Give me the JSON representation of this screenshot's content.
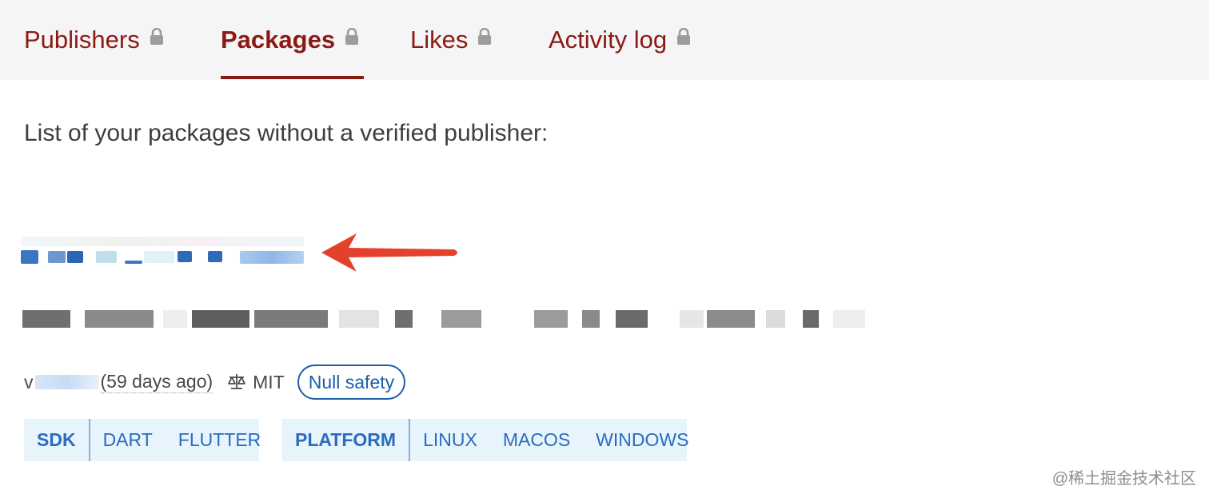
{
  "tabs": [
    {
      "label": "Publishers"
    },
    {
      "label": "Packages"
    },
    {
      "label": "Likes"
    },
    {
      "label": "Activity log"
    }
  ],
  "intro": "List of your packages without a verified publisher:",
  "package": {
    "version_prefix": "v",
    "updated": "(59 days ago)",
    "license": "MIT",
    "badge": "Null safety"
  },
  "sdk_tags": {
    "label": "SDK",
    "items": [
      "DART",
      "FLUTTER"
    ]
  },
  "platform_tags": {
    "label": "PLATFORM",
    "items": [
      "LINUX",
      "MACOS",
      "WINDOWS"
    ]
  },
  "watermark": "@稀土掘金技术社区",
  "colors": {
    "accent": "#8b1a12",
    "link": "#1c5fa8",
    "tag_bg": "#e7f4fc",
    "arrow": "#e5402c"
  },
  "icons": [
    "lock-icon",
    "balance-scale-icon",
    "red-arrow-annotation"
  ]
}
